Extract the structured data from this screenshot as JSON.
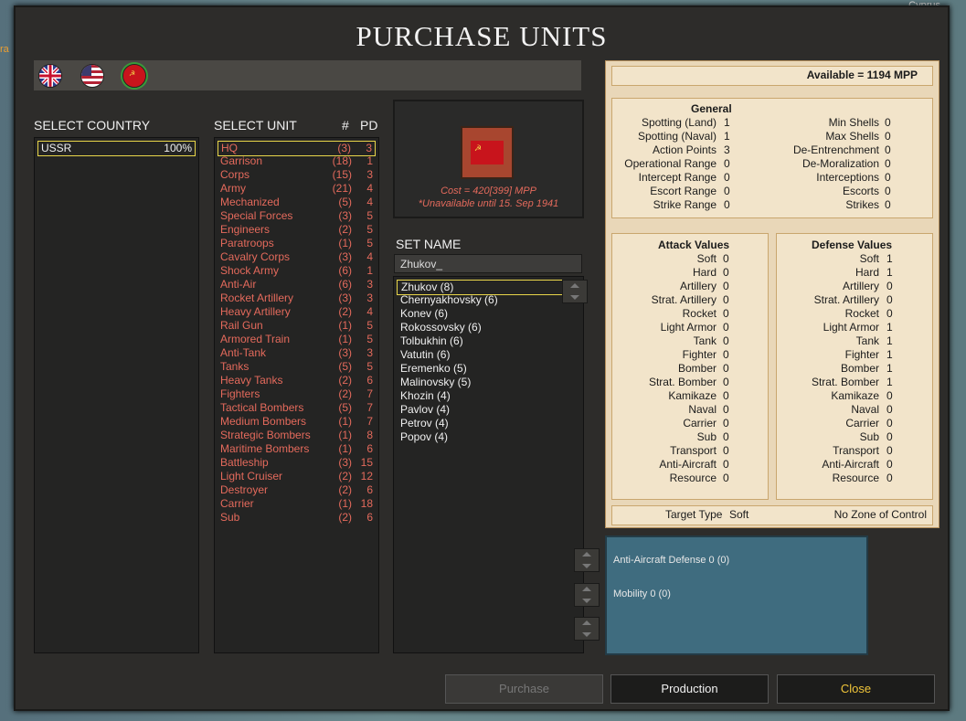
{
  "map": {
    "cyprus": "Cyprus",
    "left_label": "ra"
  },
  "title": "PURCHASE UNITS",
  "flags": [
    {
      "name": "uk",
      "selected": false
    },
    {
      "name": "usa",
      "selected": false
    },
    {
      "name": "ussr",
      "selected": true
    }
  ],
  "headers": {
    "select_country": "SELECT COUNTRY",
    "select_unit": "SELECT UNIT",
    "count": "#",
    "pd": "PD",
    "set_name": "SET NAME"
  },
  "countries": [
    {
      "name": "USSR",
      "pct": "100%"
    }
  ],
  "units": [
    {
      "name": "HQ",
      "count": "(3)",
      "pd": "3"
    },
    {
      "name": "Garrison",
      "count": "(18)",
      "pd": "1"
    },
    {
      "name": "Corps",
      "count": "(15)",
      "pd": "3"
    },
    {
      "name": "Army",
      "count": "(21)",
      "pd": "4"
    },
    {
      "name": "Mechanized",
      "count": "(5)",
      "pd": "4"
    },
    {
      "name": "Special Forces",
      "count": "(3)",
      "pd": "5"
    },
    {
      "name": "Engineers",
      "count": "(2)",
      "pd": "5"
    },
    {
      "name": "Paratroops",
      "count": "(1)",
      "pd": "5"
    },
    {
      "name": "Cavalry Corps",
      "count": "(3)",
      "pd": "4"
    },
    {
      "name": "Shock Army",
      "count": "(6)",
      "pd": "1"
    },
    {
      "name": "Anti-Air",
      "count": "(6)",
      "pd": "3"
    },
    {
      "name": "Rocket Artillery",
      "count": "(3)",
      "pd": "3"
    },
    {
      "name": "Heavy Artillery",
      "count": "(2)",
      "pd": "4"
    },
    {
      "name": "Rail Gun",
      "count": "(1)",
      "pd": "5"
    },
    {
      "name": "Armored Train",
      "count": "(1)",
      "pd": "5"
    },
    {
      "name": "Anti-Tank",
      "count": "(3)",
      "pd": "3"
    },
    {
      "name": "Tanks",
      "count": "(5)",
      "pd": "5"
    },
    {
      "name": "Heavy Tanks",
      "count": "(2)",
      "pd": "6"
    },
    {
      "name": "Fighters",
      "count": "(2)",
      "pd": "7"
    },
    {
      "name": "Tactical Bombers",
      "count": "(5)",
      "pd": "7"
    },
    {
      "name": "Medium Bombers",
      "count": "(1)",
      "pd": "7"
    },
    {
      "name": "Strategic Bombers",
      "count": "(1)",
      "pd": "8"
    },
    {
      "name": "Maritime Bombers",
      "count": "(1)",
      "pd": "6"
    },
    {
      "name": "Battleship",
      "count": "(3)",
      "pd": "15"
    },
    {
      "name": "Light Cruiser",
      "count": "(2)",
      "pd": "12"
    },
    {
      "name": "Destroyer",
      "count": "(2)",
      "pd": "6"
    },
    {
      "name": "Carrier",
      "count": "(1)",
      "pd": "18"
    },
    {
      "name": "Sub",
      "count": "(2)",
      "pd": "6"
    }
  ],
  "unit_preview": {
    "cost": "Cost = 420[399] MPP",
    "unavailable": "*Unavailable until 15. Sep 1941"
  },
  "set_name": {
    "value": "Zhukov_"
  },
  "names": [
    "Zhukov (8)",
    "Chernyakhovsky (6)",
    "Konev (6)",
    "Rokossovsky (6)",
    "Tolbukhin (6)",
    "Vatutin (6)",
    "Eremenko (5)",
    "Malinovsky (5)",
    "Khozin (4)",
    "Pavlov (4)",
    "Petrov (4)",
    "Popov (4)"
  ],
  "available": "Available = 1194 MPP",
  "general": {
    "title": "General",
    "left": [
      {
        "k": "Spotting (Land)",
        "v": "1"
      },
      {
        "k": "Spotting (Naval)",
        "v": "1"
      },
      {
        "k": "Action Points",
        "v": "3"
      },
      {
        "k": "Operational Range",
        "v": "0"
      },
      {
        "k": "Intercept Range",
        "v": "0"
      },
      {
        "k": "Escort Range",
        "v": "0"
      },
      {
        "k": "Strike Range",
        "v": "0"
      }
    ],
    "right": [
      {
        "k": "Min Shells",
        "v": "0"
      },
      {
        "k": "Max Shells",
        "v": "0"
      },
      {
        "k": "De-Entrenchment",
        "v": "0"
      },
      {
        "k": "De-Moralization",
        "v": "0"
      },
      {
        "k": "Interceptions",
        "v": "0"
      },
      {
        "k": "Escorts",
        "v": "0"
      },
      {
        "k": "Strikes",
        "v": "0"
      }
    ]
  },
  "attack": {
    "title": "Attack Values",
    "rows": [
      {
        "k": "Soft",
        "v": "0"
      },
      {
        "k": "Hard",
        "v": "0"
      },
      {
        "k": "Artillery",
        "v": "0"
      },
      {
        "k": "Strat. Artillery",
        "v": "0"
      },
      {
        "k": "Rocket",
        "v": "0"
      },
      {
        "k": "Light Armor",
        "v": "0"
      },
      {
        "k": "Tank",
        "v": "0"
      },
      {
        "k": "Fighter",
        "v": "0"
      },
      {
        "k": "Bomber",
        "v": "0"
      },
      {
        "k": "Strat. Bomber",
        "v": "0"
      },
      {
        "k": "Kamikaze",
        "v": "0"
      },
      {
        "k": "Naval",
        "v": "0"
      },
      {
        "k": "Carrier",
        "v": "0"
      },
      {
        "k": "Sub",
        "v": "0"
      },
      {
        "k": "Transport",
        "v": "0"
      },
      {
        "k": "Anti-Aircraft",
        "v": "0"
      },
      {
        "k": "Resource",
        "v": "0"
      }
    ]
  },
  "defense": {
    "title": "Defense Values",
    "rows": [
      {
        "k": "Soft",
        "v": "1"
      },
      {
        "k": "Hard",
        "v": "1"
      },
      {
        "k": "Artillery",
        "v": "0"
      },
      {
        "k": "Strat. Artillery",
        "v": "0"
      },
      {
        "k": "Rocket",
        "v": "0"
      },
      {
        "k": "Light Armor",
        "v": "1"
      },
      {
        "k": "Tank",
        "v": "1"
      },
      {
        "k": "Fighter",
        "v": "1"
      },
      {
        "k": "Bomber",
        "v": "1"
      },
      {
        "k": "Strat. Bomber",
        "v": "1"
      },
      {
        "k": "Kamikaze",
        "v": "0"
      },
      {
        "k": "Naval",
        "v": "0"
      },
      {
        "k": "Carrier",
        "v": "0"
      },
      {
        "k": "Sub",
        "v": "0"
      },
      {
        "k": "Transport",
        "v": "0"
      },
      {
        "k": "Anti-Aircraft",
        "v": "0"
      },
      {
        "k": "Resource",
        "v": "0"
      }
    ]
  },
  "target": {
    "label": "Target Type",
    "value": "Soft",
    "zoc": "No Zone of Control"
  },
  "upgrades": [
    {
      "text": "Anti-Aircraft Defense 0  (0)"
    },
    {
      "text": "Mobility 0  (0)"
    }
  ],
  "buttons": {
    "purchase": "Purchase",
    "production": "Production",
    "close": "Close"
  },
  "colors": {
    "unit_red": "#e46a5c",
    "selection_yellow": "#e9d64a",
    "close_yellow": "#f0c53a"
  }
}
